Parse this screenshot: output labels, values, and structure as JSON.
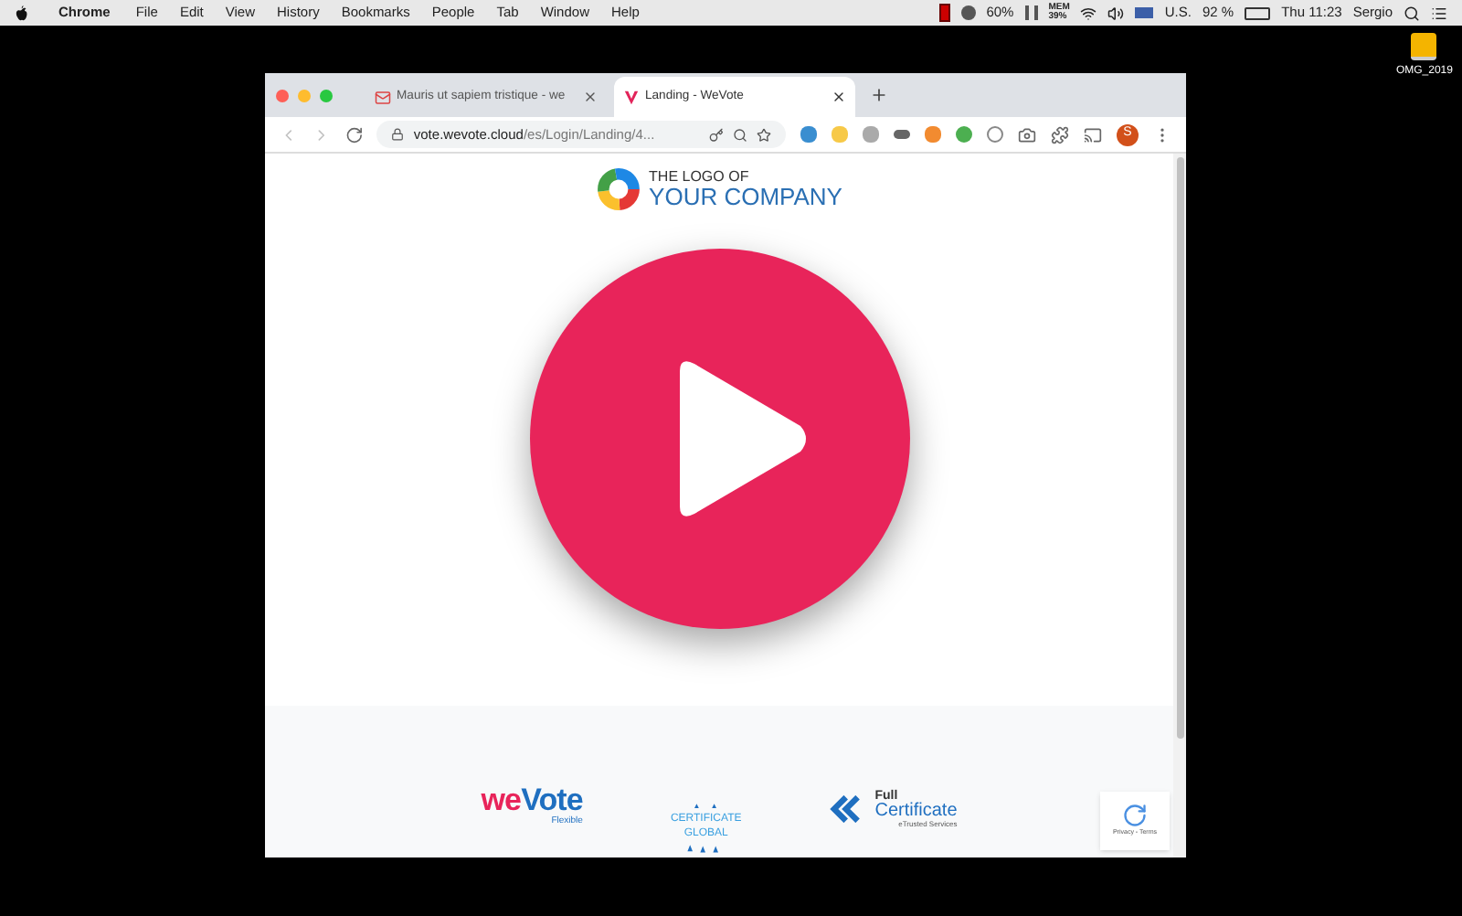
{
  "menu_bar": {
    "app": "Chrome",
    "items": [
      "File",
      "Edit",
      "View",
      "History",
      "Bookmarks",
      "People",
      "Tab",
      "Window",
      "Help"
    ],
    "status": {
      "cpu": "60%",
      "mem_label": "MEM",
      "mem_value": "39%",
      "input": "U.S.",
      "battery": "92 %",
      "clock": "Thu 11:23",
      "user": "Sergio"
    }
  },
  "desktop": {
    "icon_label": "OMG_2019"
  },
  "browser": {
    "tabs": [
      {
        "title": "Mauris ut sapiem tristique - we",
        "kind": "mail",
        "selected": false
      },
      {
        "title": "Landing - WeVote",
        "kind": "site",
        "selected": true
      }
    ],
    "url": {
      "host": "vote.wevote.cloud",
      "path": "/es/Login/Landing/4..."
    },
    "profile": "S"
  },
  "page": {
    "logo": {
      "line1": "THE LOGO OF",
      "line2": "YOUR COMPANY"
    },
    "footer": {
      "brand_we": "we",
      "brand_vote": "Vote",
      "brand_tag": "Flexible",
      "cert1_line1": "CERTIFICATE",
      "cert1_line2": "GLOBAL",
      "cert2_line1": "Full",
      "cert2_line2": "Certificate",
      "cert2_tag": "eTrusted Services",
      "recaptcha": "Privacy - Terms"
    }
  }
}
